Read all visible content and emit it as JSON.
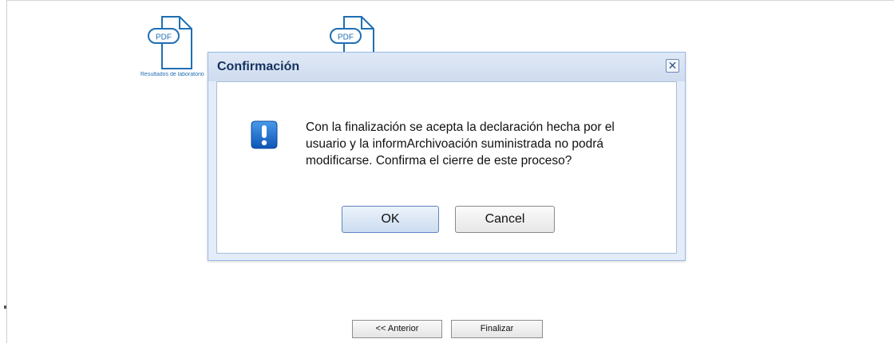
{
  "documents": [
    {
      "badge": "PDF",
      "caption": "Resultados de laboratorio"
    },
    {
      "badge": "PDF",
      "caption": ""
    }
  ],
  "dialog": {
    "title": "Confirmación",
    "close_glyph": "✕",
    "icon": "exclamation-icon",
    "message": "Con la finalización se acepta la declaración hecha por el usuario y la informArchivoación suministrada no podrá modificarse. Confirma el cierre de este proceso?",
    "ok_label": "OK",
    "cancel_label": "Cancel"
  },
  "navigation": {
    "previous_label": "<< Anterior",
    "finish_label": "Finalizar"
  },
  "colors": {
    "dialog_border": "#99bbe8",
    "title_text": "#15315e",
    "icon_blue": "#1a6fd1",
    "pdf_blue": "#1f6fb5"
  }
}
